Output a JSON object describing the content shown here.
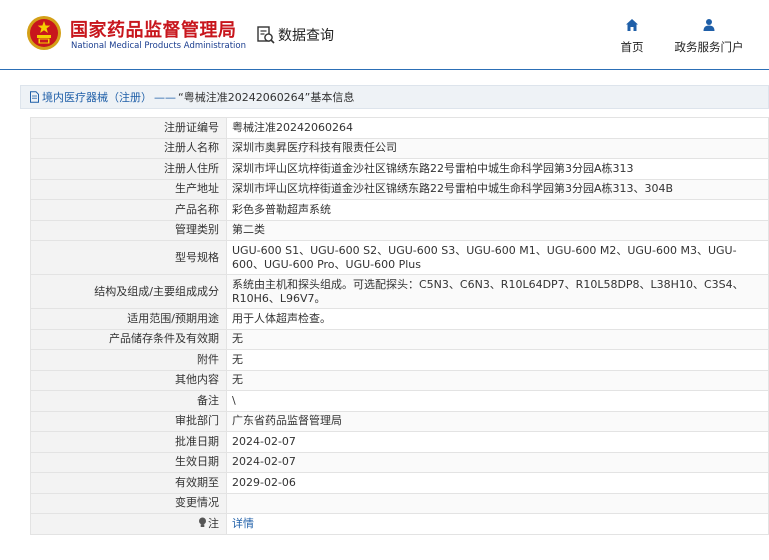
{
  "header": {
    "brand_cn": "国家药品监督管理局",
    "brand_en": "National Medical Products Administration",
    "query_label": "数据查询",
    "nav": [
      {
        "label": "首页",
        "icon": "home-icon"
      },
      {
        "label": "政务服务门户",
        "icon": "user-icon"
      }
    ]
  },
  "colors": {
    "brand_red": "#c8161d",
    "brand_blue": "#1a3d8f",
    "link_blue": "#1f5fa8",
    "header_rule": "#2c6fb6"
  },
  "breadcrumb": {
    "section": "境内医疗器械（注册）",
    "separator": "——",
    "title": "“粤械注准20242060264”基本信息"
  },
  "details": [
    {
      "label": "注册证编号",
      "value": "粤械注准20242060264"
    },
    {
      "label": "注册人名称",
      "value": "深圳市奥昇医疗科技有限责任公司"
    },
    {
      "label": "注册人住所",
      "value": "深圳市坪山区坑梓街道金沙社区锦绣东路22号雷柏中城生命科学园第3分园A栋313"
    },
    {
      "label": "生产地址",
      "value": "深圳市坪山区坑梓街道金沙社区锦绣东路22号雷柏中城生命科学园第3分园A栋313、304B"
    },
    {
      "label": "产品名称",
      "value": "彩色多普勒超声系统"
    },
    {
      "label": "管理类别",
      "value": "第二类"
    },
    {
      "label": "型号规格",
      "value": "UGU-600 S1、UGU-600 S2、UGU-600 S3、UGU-600 M1、UGU-600 M2、UGU-600 M3、UGU-600、UGU-600 Pro、UGU-600 Plus"
    },
    {
      "label": "结构及组成/主要组成成分",
      "value": "系统由主机和探头组成。可选配探头：C5N3、C6N3、R10L64DP7、R10L58DP8、L38H10、C3S4、R10H6、L96V7。"
    },
    {
      "label": "适用范围/预期用途",
      "value": "用于人体超声检查。"
    },
    {
      "label": "产品储存条件及有效期",
      "value": "无"
    },
    {
      "label": "附件",
      "value": "无"
    },
    {
      "label": "其他内容",
      "value": "无"
    },
    {
      "label": "备注",
      "value": "\\"
    },
    {
      "label": "审批部门",
      "value": "广东省药品监督管理局"
    },
    {
      "label": "批准日期",
      "value": "2024-02-07"
    },
    {
      "label": "生效日期",
      "value": "2024-02-07"
    },
    {
      "label": "有效期至",
      "value": "2029-02-06"
    },
    {
      "label": "变更情况",
      "value": ""
    },
    {
      "label": "注",
      "value": "详情",
      "icon": "lightbulb-icon"
    }
  ]
}
